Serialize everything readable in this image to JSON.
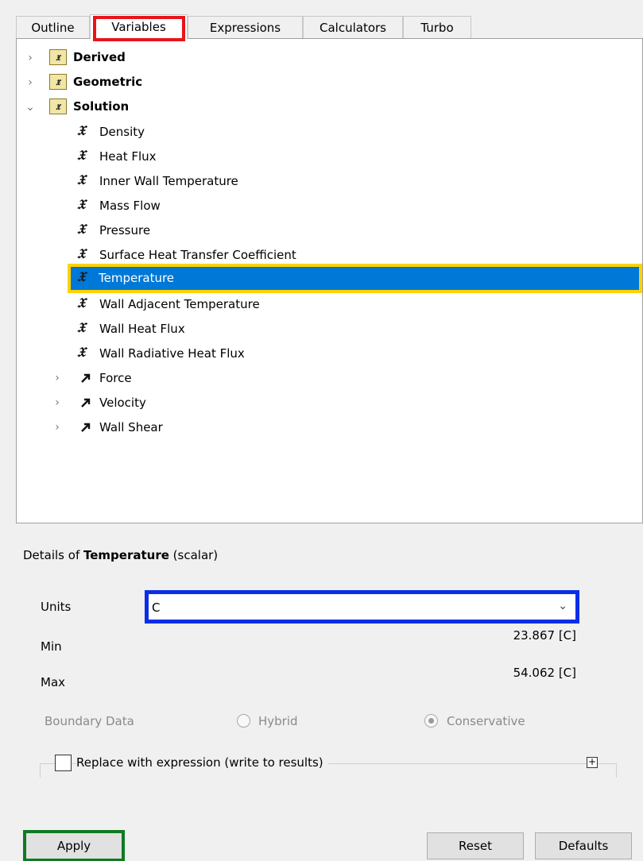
{
  "tabs": [
    {
      "label": "Outline"
    },
    {
      "label": "Variables"
    },
    {
      "label": "Expressions"
    },
    {
      "label": "Calculators"
    },
    {
      "label": "Turbo"
    }
  ],
  "tree": {
    "groups": [
      {
        "label": "Derived"
      },
      {
        "label": "Geometric"
      },
      {
        "label": "Solution"
      }
    ],
    "solution_items": [
      {
        "label": "Density"
      },
      {
        "label": "Heat Flux"
      },
      {
        "label": "Inner Wall Temperature"
      },
      {
        "label": "Mass Flow"
      },
      {
        "label": "Pressure"
      },
      {
        "label": "Surface Heat Transfer Coefficient"
      },
      {
        "label": "Temperature"
      },
      {
        "label": "Wall Adjacent Temperature"
      },
      {
        "label": "Wall Heat Flux"
      },
      {
        "label": "Wall Radiative Heat Flux"
      }
    ],
    "vector_items": [
      {
        "label": "Force"
      },
      {
        "label": "Velocity"
      },
      {
        "label": "Wall Shear"
      }
    ],
    "selected": "Temperature"
  },
  "details": {
    "prefix": "Details of ",
    "name": "Temperature",
    "suffix": " (scalar)",
    "units_label": "Units",
    "units_value": "C",
    "min_label": "Min",
    "min_value": "23.867 [C]",
    "max_label": "Max",
    "max_value": "54.062 [C]",
    "boundary_label": "Boundary Data",
    "hybrid_label": "Hybrid",
    "conservative_label": "Conservative",
    "replace_label": "Replace with expression (write to results)"
  },
  "buttons": {
    "apply": "Apply",
    "reset": "Reset",
    "defaults": "Defaults"
  },
  "colors": {
    "selection": "#0078d7",
    "selection_outline": "#ffd200",
    "tab_highlight": "#e8141a",
    "units_highlight": "#0a2ee8",
    "apply_highlight": "#0f7a22"
  }
}
